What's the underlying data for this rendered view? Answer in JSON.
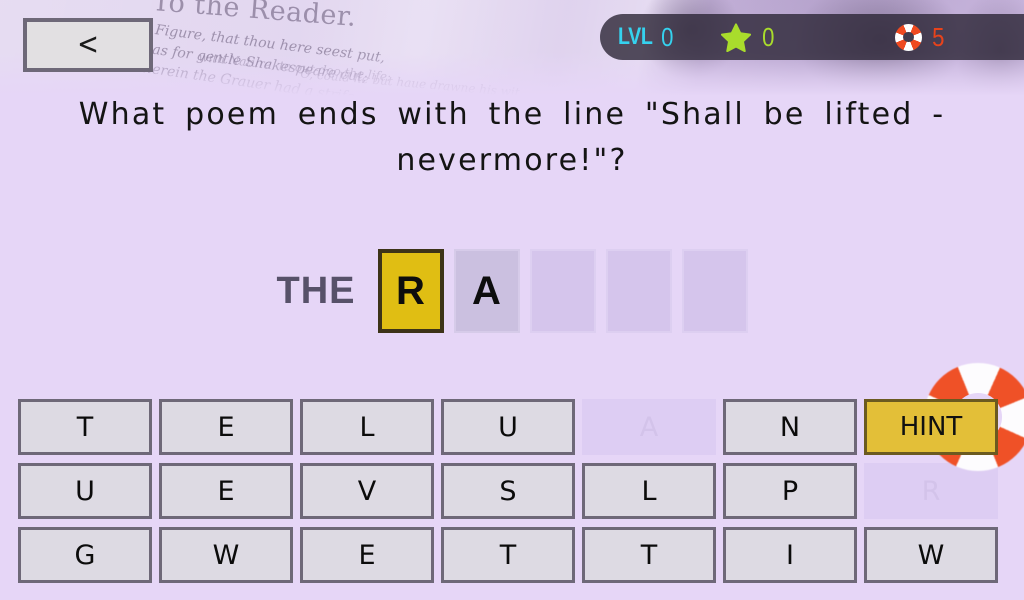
{
  "header": {
    "back_label": "<",
    "back_icon": "chevron-left-icon",
    "art_title": "To the Reader.",
    "art_line1": "This Figure, that thou here seest put,",
    "art_line2": "It was for gentle Shakespeare cut;",
    "art_line3": "Wherein the Grauer had a strife",
    "art_line4": "with Nature, to out-doo the life:",
    "art_line5": "O, could he but haue drawne his wit"
  },
  "status": {
    "level_label": "LVL",
    "level_value": "0",
    "star_icon": "star-icon",
    "star_value": "0",
    "lifering_icon": "life-ring-icon",
    "lifering_value": "5"
  },
  "question": {
    "text": "What poem ends with the line \"Shall be lifted - nevermore!\"?"
  },
  "answer": {
    "prefix": "THE",
    "slots": [
      {
        "letter": "R",
        "state": "current"
      },
      {
        "letter": "A",
        "state": "filled"
      },
      {
        "letter": "",
        "state": "empty"
      },
      {
        "letter": "",
        "state": "empty"
      },
      {
        "letter": "",
        "state": "empty"
      }
    ]
  },
  "keyboard": {
    "hint_label": "HINT",
    "rows": [
      [
        {
          "letter": "T",
          "state": "available"
        },
        {
          "letter": "E",
          "state": "available"
        },
        {
          "letter": "L",
          "state": "available"
        },
        {
          "letter": "U",
          "state": "available"
        },
        {
          "letter": "A",
          "state": "used"
        },
        {
          "letter": "N",
          "state": "available"
        },
        {
          "letter": "HINT",
          "state": "hint"
        }
      ],
      [
        {
          "letter": "U",
          "state": "available"
        },
        {
          "letter": "E",
          "state": "available"
        },
        {
          "letter": "V",
          "state": "available"
        },
        {
          "letter": "S",
          "state": "available"
        },
        {
          "letter": "L",
          "state": "available"
        },
        {
          "letter": "P",
          "state": "available"
        },
        {
          "letter": "R",
          "state": "used"
        }
      ],
      [
        {
          "letter": "G",
          "state": "available"
        },
        {
          "letter": "W",
          "state": "available"
        },
        {
          "letter": "E",
          "state": "available"
        },
        {
          "letter": "T",
          "state": "available"
        },
        {
          "letter": "T",
          "state": "available"
        },
        {
          "letter": "I",
          "state": "available"
        },
        {
          "letter": "W",
          "state": "available"
        }
      ]
    ]
  },
  "colors": {
    "page_background": "#e6d6f7",
    "level_text": "#35d2ef",
    "star_text": "#a9dc2c",
    "lifering_text": "#e8431b",
    "current_slot": "#e0be13",
    "hint_button": "#e3bf38",
    "key_face": "#dddae3",
    "key_border": "#6e6878",
    "prefix_text": "#575169"
  }
}
